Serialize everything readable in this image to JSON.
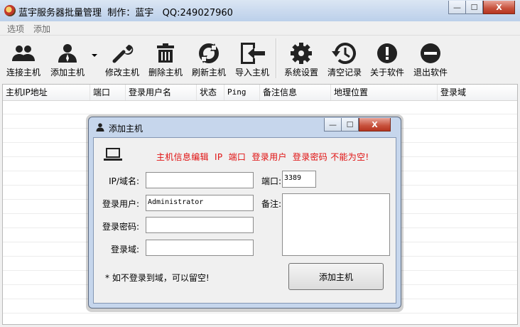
{
  "window": {
    "title": "蓝宇服务器批量管理  制作：蓝宇   QQ:249027960",
    "min": "—",
    "max": "☐",
    "close": "X"
  },
  "menu": {
    "options": "选项",
    "add": "添加"
  },
  "toolbar": {
    "connect": "连接主机",
    "add": "添加主机",
    "edit": "修改主机",
    "delete": "删除主机",
    "refresh": "刷新主机",
    "import": "导入主机",
    "settings": "系统设置",
    "clear_log": "清空记录",
    "about": "关于软件",
    "exit": "退出软件"
  },
  "table": {
    "columns": [
      "主机IP地址",
      "端口",
      "登录用户名",
      "状态",
      "Ping",
      "备注信息",
      "地理位置",
      "登录域"
    ]
  },
  "dialog": {
    "title": "添加主机",
    "warning": "主机信息编辑  IP  端口  登录用户  登录密码 不能为空!",
    "ip_label": "IP/域名:",
    "ip_value": "",
    "port_label": "端口:",
    "port_value": "3389",
    "user_label": "登录用户:",
    "user_value": "Administrator",
    "password_label": "登录密码:",
    "password_value": "",
    "domain_label": "登录域:",
    "domain_value": "",
    "note_label": "备注:",
    "note_value": "",
    "hint": "* 如不登录到域，可以留空!",
    "submit": "添加主机"
  },
  "colors": {
    "warning": "#e01010",
    "dialog_frame": "#c6d6ec"
  },
  "icons": [
    "users-icon",
    "user-add-icon",
    "wrench-icon",
    "trash-icon",
    "refresh-icon",
    "import-icon",
    "gear-icon",
    "history-icon",
    "info-icon",
    "exit-icon",
    "laptop-icon"
  ]
}
